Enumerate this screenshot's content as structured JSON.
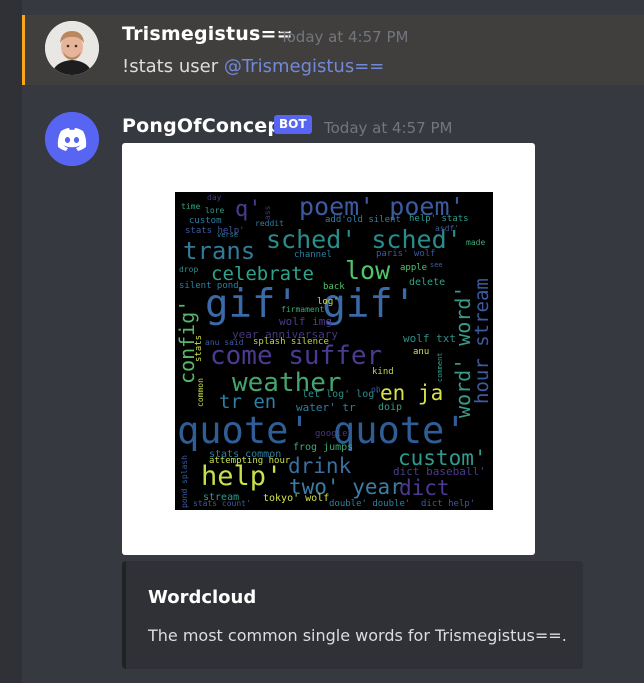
{
  "messages": [
    {
      "username": "Trismegistus==",
      "timestamp": "Today at 4:57 PM",
      "text_prefix": "!stats user ",
      "mention": "@Trismegistus=="
    },
    {
      "username": "PongOfConcept",
      "bot_tag": "BOT",
      "timestamp": "Today at 4:57 PM"
    }
  ],
  "embed": {
    "title": "Wordcloud",
    "description": "The most common single words for Trismegistus==."
  },
  "wordcloud": [
    {
      "text": "gif' gif'",
      "color": "#3b6aa8"
    },
    {
      "text": "quote' quote'",
      "color": "#2f5d96"
    },
    {
      "text": "come suffer",
      "color": "#4b3a8f"
    },
    {
      "text": "weather",
      "color": "#46a36f"
    },
    {
      "text": "sched' sched'",
      "color": "#2b8c8a"
    },
    {
      "text": "poem' poem'",
      "color": "#3d5aa1"
    },
    {
      "text": "trans",
      "color": "#327a98"
    },
    {
      "text": "celebrate",
      "color": "#2fa38a"
    },
    {
      "text": "low",
      "color": "#50c46a"
    },
    {
      "text": "help'",
      "color": "#c8e04b"
    },
    {
      "text": "drink",
      "color": "#3a6e9e"
    },
    {
      "text": "two' year",
      "color": "#3c7ea3"
    },
    {
      "text": "dict",
      "color": "#4b3a8f"
    },
    {
      "text": "custom'",
      "color": "#2f9c8e"
    },
    {
      "text": "en ja",
      "color": "#d6e34a"
    },
    {
      "text": "tr en",
      "color": "#2e7fa3"
    },
    {
      "text": "config'",
      "color": "#55b86a"
    },
    {
      "text": "word' word'",
      "color": "#3b9b88"
    },
    {
      "text": "hour stream",
      "color": "#3d5aa1"
    },
    {
      "text": "q'",
      "color": "#4b3a8f"
    },
    {
      "text": "year anniversary",
      "color": "#48367c"
    },
    {
      "text": "wolf img",
      "color": "#4a3d8d"
    },
    {
      "text": "splash silence",
      "color": "#b8d84a"
    },
    {
      "text": "wolf txt",
      "color": "#2f8c8a"
    },
    {
      "text": "frog jumps",
      "color": "#3fa87a"
    },
    {
      "text": "stats common",
      "color": "#2e7fa3"
    },
    {
      "text": "dict baseball'",
      "color": "#4a3d8d"
    },
    {
      "text": "tokyo' wolf",
      "color": "#d6e34a"
    },
    {
      "text": "double' double'",
      "color": "#2e7fa3"
    },
    {
      "text": "dict help'",
      "color": "#3b5aa1"
    },
    {
      "text": "stream",
      "color": "#2f9c8e"
    },
    {
      "text": "attempting hour",
      "color": "#c8e04b"
    },
    {
      "text": "stats count'",
      "color": "#3d5aa1"
    },
    {
      "text": "pond splash",
      "color": "#3b5aa1"
    },
    {
      "text": "google",
      "color": "#48367c"
    },
    {
      "text": "water' tr",
      "color": "#2e7fa3"
    },
    {
      "text": "doip",
      "color": "#3b9b88"
    },
    {
      "text": "let log' log'",
      "color": "#2f8c8a"
    },
    {
      "text": "kind",
      "color": "#b8d84a"
    },
    {
      "text": "anu",
      "color": "#c8e04b"
    },
    {
      "text": "delete",
      "color": "#2fa38a"
    },
    {
      "text": "apple",
      "color": "#50c46a"
    },
    {
      "text": "paris' wolf",
      "color": "#3d5aa1"
    },
    {
      "text": "channel",
      "color": "#2e7fa3"
    },
    {
      "text": "back",
      "color": "#50c46a"
    },
    {
      "text": "log'",
      "color": "#c8e04b"
    },
    {
      "text": "firmament",
      "color": "#3fa87a"
    },
    {
      "text": "anu said",
      "color": "#3d5aa1"
    },
    {
      "text": "silent pond",
      "color": "#2e7fa3"
    },
    {
      "text": "drop",
      "color": "#2f8c8a"
    },
    {
      "text": "custom",
      "color": "#2e7fa3"
    },
    {
      "text": "stats help'",
      "color": "#3d5aa1"
    },
    {
      "text": "lore",
      "color": "#3b9b88"
    },
    {
      "text": "time",
      "color": "#2fa38a"
    },
    {
      "text": "day",
      "color": "#48367c"
    },
    {
      "text": "verse",
      "color": "#2e7fa3"
    },
    {
      "text": "reddit",
      "color": "#2e7fa3"
    },
    {
      "text": "ass",
      "color": "#48367c"
    },
    {
      "text": "add'old silent",
      "color": "#2e7fa3"
    },
    {
      "text": "help' stats",
      "color": "#2f9c8e"
    },
    {
      "text": "asdf'",
      "color": "#3d5aa1"
    },
    {
      "text": "made",
      "color": "#3fa87a"
    },
    {
      "text": "see",
      "color": "#3d5aa1"
    },
    {
      "text": "stats",
      "color": "#c8e04b"
    },
    {
      "text": "common",
      "color": "#c8e04b"
    },
    {
      "text": "comment",
      "color": "#3b9b88"
    },
    {
      "text": "oh",
      "color": "#3d5aa1"
    }
  ]
}
